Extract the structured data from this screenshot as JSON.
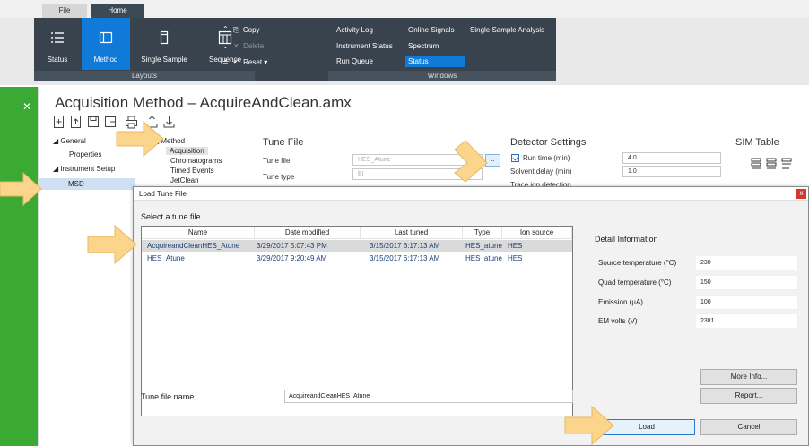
{
  "ribbon": {
    "tabs": [
      "File",
      "Home"
    ],
    "layouts": {
      "buttons": [
        "Status",
        "Method",
        "Single Sample",
        "Sequence"
      ],
      "group_label": "Layouts"
    },
    "commands": [
      "Copy",
      "Delete",
      "Reset"
    ],
    "windows": {
      "col1": [
        "Activity Log",
        "Instrument Status",
        "Run Queue"
      ],
      "col2": [
        "Online Signals",
        "Spectrum",
        "Status"
      ],
      "col3": [
        "Single Sample Analysis"
      ],
      "group_label": "Windows"
    }
  },
  "method": {
    "title": "Acquisition Method – AcquireAndClean.amx",
    "tree": {
      "general": "General",
      "properties": "Properties",
      "instrument_setup": "Instrument Setup",
      "msd": "MSD"
    },
    "submenu": {
      "header": "Method",
      "items": [
        "Acquisition",
        "Chromatograms",
        "Timed Events",
        "JetClean"
      ]
    },
    "tune": {
      "header": "Tune File",
      "file_label": "Tune file",
      "file_value": "HES_Atune",
      "type_label": "Tune type",
      "type_value": "EI",
      "browse": ".."
    },
    "detector": {
      "header": "Detector Settings",
      "run_time_label": "Run time (min)",
      "run_time_value": "4.0",
      "solvent_delay_label": "Solvent delay (min)",
      "solvent_delay_value": "1.0",
      "trace_label": "Trace ion detection"
    },
    "sim": {
      "header": "SIM Table"
    }
  },
  "dialog": {
    "title": "Load Tune File",
    "close": "x",
    "select_label": "Select a tune file",
    "columns": [
      "Name",
      "Date modified",
      "Last tuned",
      "Type",
      "Ion source"
    ],
    "rows": [
      {
        "name": "AcquireandCleanHES_Atune",
        "modified": "3/29/2017 5:07:43 PM",
        "tuned": "3/15/2017 6:17:13 AM",
        "type": "HES_atune",
        "source": "HES"
      },
      {
        "name": "HES_Atune",
        "modified": "3/29/2017 9:20:49 AM",
        "tuned": "3/15/2017 6:17:13 AM",
        "type": "HES_atune",
        "source": "HES"
      }
    ],
    "file_name_label": "Tune file name",
    "file_name_value": "AcquireandCleanHES_Atune",
    "detail": {
      "header": "Detail Information",
      "items": [
        {
          "label": "Source temperature (°C)",
          "value": "230"
        },
        {
          "label": "Quad temperature (°C)",
          "value": "150"
        },
        {
          "label": "Emission (µA)",
          "value": "100"
        },
        {
          "label": "EM volts (V)",
          "value": "2381"
        }
      ]
    },
    "buttons": {
      "more_info": "More Info...",
      "report": "Report...",
      "load": "Load",
      "cancel": "Cancel"
    }
  },
  "colors": {
    "ribbon_dark": "#38434d",
    "accent_blue": "#0f7ad8",
    "side_green": "#3aaa35",
    "arrow": "#fcd58c",
    "close_red": "#d9342b"
  }
}
